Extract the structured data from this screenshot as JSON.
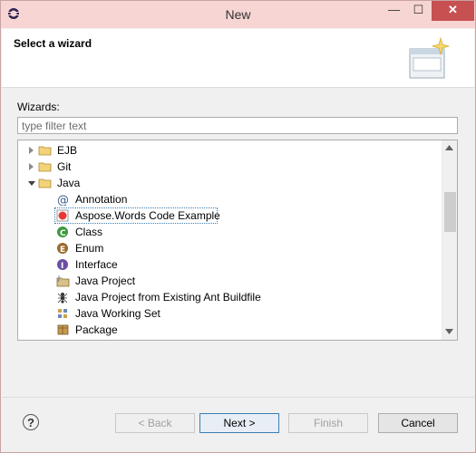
{
  "window": {
    "title": "New",
    "min_glyph": "—",
    "max_glyph": "☐",
    "close_glyph": "✕"
  },
  "header": {
    "title": "Select a wizard"
  },
  "wizards": {
    "label": "Wizards:",
    "filter_placeholder": "type filter text",
    "filter_value": ""
  },
  "tree": {
    "items": [
      {
        "label": "EJB",
        "icon": "folder-icon",
        "expand": "collapsed",
        "indent": 0
      },
      {
        "label": "Git",
        "icon": "folder-icon",
        "expand": "collapsed",
        "indent": 0
      },
      {
        "label": "Java",
        "icon": "folder-icon",
        "expand": "expanded",
        "indent": 0
      },
      {
        "label": "Annotation",
        "icon": "annotation-icon",
        "indent": 1
      },
      {
        "label": "Aspose.Words Code Example",
        "icon": "aspose-icon",
        "indent": 1,
        "selected": true
      },
      {
        "label": "Class",
        "icon": "class-icon",
        "indent": 1
      },
      {
        "label": "Enum",
        "icon": "enum-icon",
        "indent": 1
      },
      {
        "label": "Interface",
        "icon": "interface-icon",
        "indent": 1
      },
      {
        "label": "Java Project",
        "icon": "java-project-icon",
        "indent": 1
      },
      {
        "label": "Java Project from Existing Ant Buildfile",
        "icon": "ant-icon",
        "indent": 1
      },
      {
        "label": "Java Working Set",
        "icon": "working-set-icon",
        "indent": 1
      },
      {
        "label": "Package",
        "icon": "package-icon",
        "indent": 1
      }
    ]
  },
  "buttons": {
    "help": "?",
    "back": "< Back",
    "next": "Next >",
    "finish": "Finish",
    "cancel": "Cancel"
  }
}
